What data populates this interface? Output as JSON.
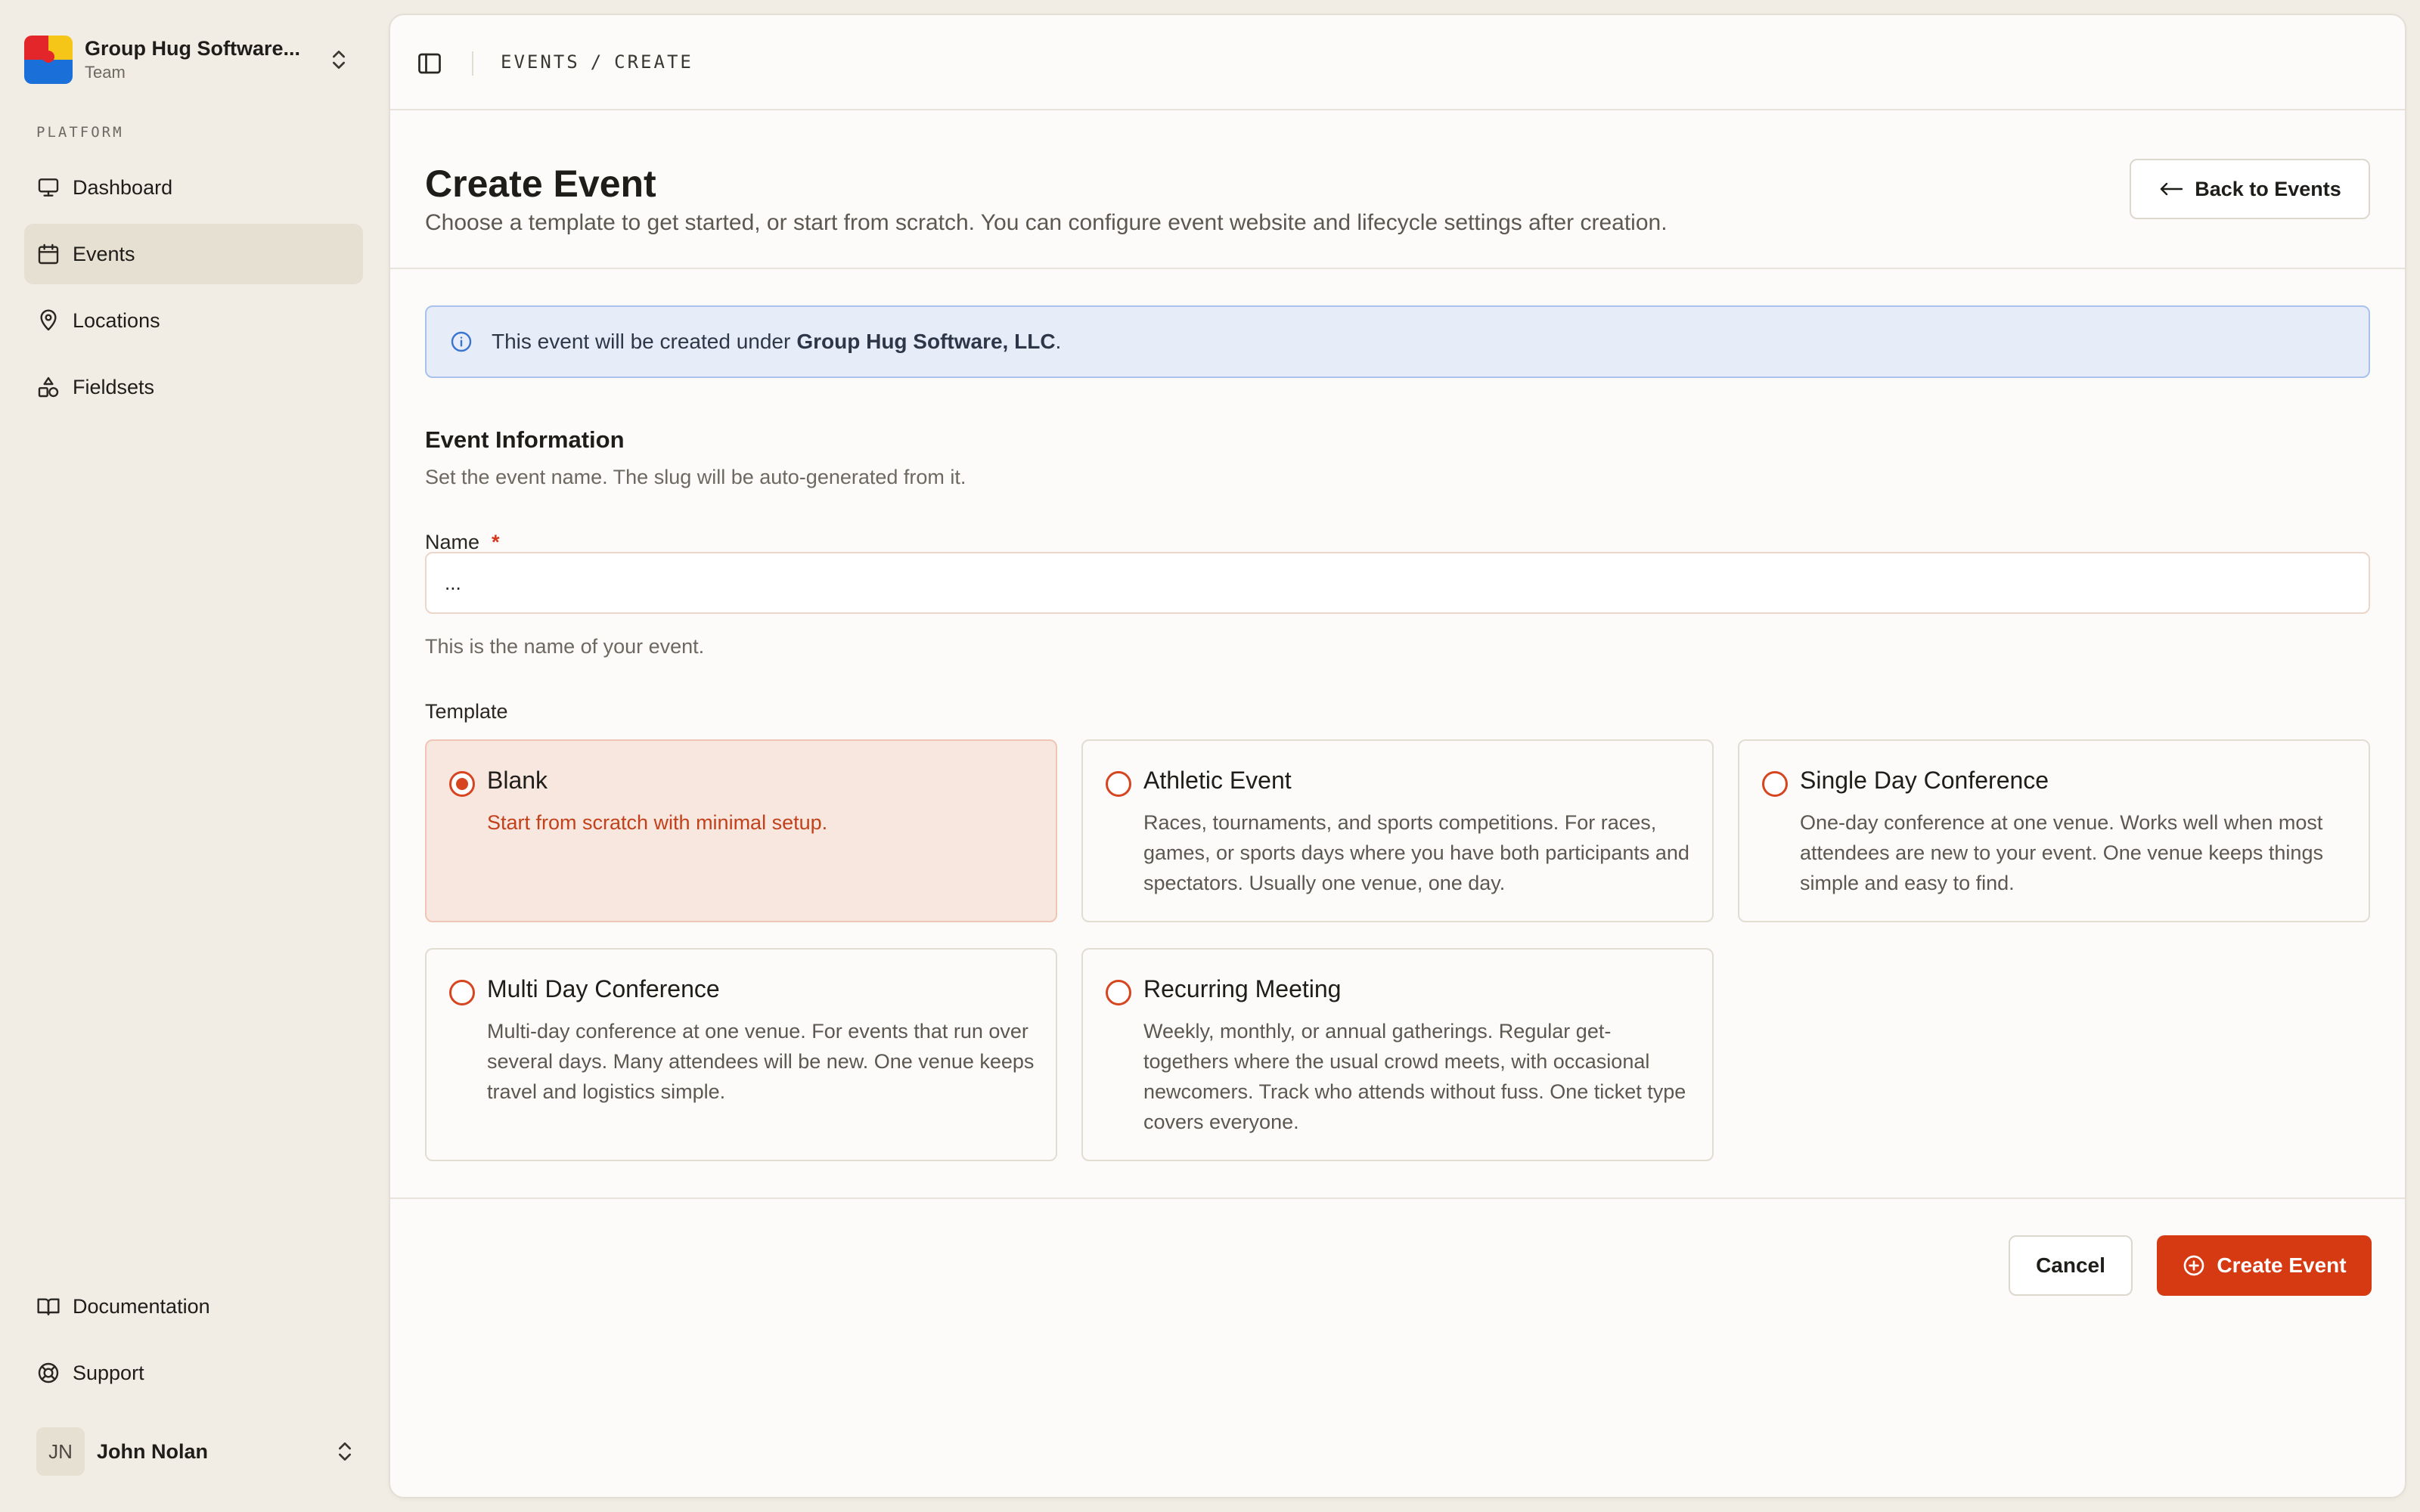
{
  "team": {
    "name": "Group Hug Software...",
    "role": "Team"
  },
  "sidebar": {
    "section_label": "PLATFORM",
    "items": [
      {
        "label": "Dashboard",
        "icon": "monitor-icon"
      },
      {
        "label": "Events",
        "icon": "calendar-icon",
        "active": true
      },
      {
        "label": "Locations",
        "icon": "map-pin-icon"
      },
      {
        "label": "Fieldsets",
        "icon": "shapes-icon"
      }
    ],
    "bottom_items": [
      {
        "label": "Documentation",
        "icon": "book-icon"
      },
      {
        "label": "Support",
        "icon": "life-buoy-icon"
      }
    ]
  },
  "user": {
    "initials": "JN",
    "name": "John Nolan"
  },
  "breadcrumb": {
    "items": [
      "EVENTS",
      "/",
      "CREATE"
    ]
  },
  "header": {
    "title": "Create Event",
    "subtitle": "Choose a template to get started, or start from scratch. You can configure event website and lifecycle settings after creation.",
    "back_label": "Back to Events"
  },
  "banner": {
    "prefix": "This event will be created under",
    "org": "Group Hug Software, LLC",
    "suffix": "."
  },
  "form": {
    "section_title": "Event Information",
    "section_desc": "Set the event name. The slug will be auto-generated from it.",
    "name_label": "Name",
    "required_mark": "*",
    "name_placeholder": "...",
    "name_value": "",
    "name_help": "This is the name of your event.",
    "template_label": "Template"
  },
  "templates": [
    {
      "title": "Blank",
      "desc": "Start from scratch with minimal setup.",
      "selected": true
    },
    {
      "title": "Athletic Event",
      "desc": "Races, tournaments, and sports competitions. For races, games, or sports days where you have both participants and spectators. Usually one venue, one day.",
      "selected": false
    },
    {
      "title": "Single Day Conference",
      "desc": "One-day conference at one venue. Works well when most attendees are new to your event. One venue keeps things simple and easy to find.",
      "selected": false
    },
    {
      "title": "Multi Day Conference",
      "desc": "Multi-day conference at one venue. For events that run over several days. Many attendees will be new. One venue keeps travel and logistics simple.",
      "selected": false
    },
    {
      "title": "Recurring Meeting",
      "desc": "Weekly, monthly, or annual gatherings. Regular get-togethers where the usual crowd meets, with occasional newcomers. Track who attends without fuss. One ticket type covers everyone.",
      "selected": false
    }
  ],
  "actions": {
    "cancel_label": "Cancel",
    "create_label": "Create Event"
  },
  "colors": {
    "accent": "#d63a12",
    "selected_card_bg": "#f8e7df",
    "banner_bg": "#e6edf9",
    "sidebar_bg": "#f1ede4"
  }
}
